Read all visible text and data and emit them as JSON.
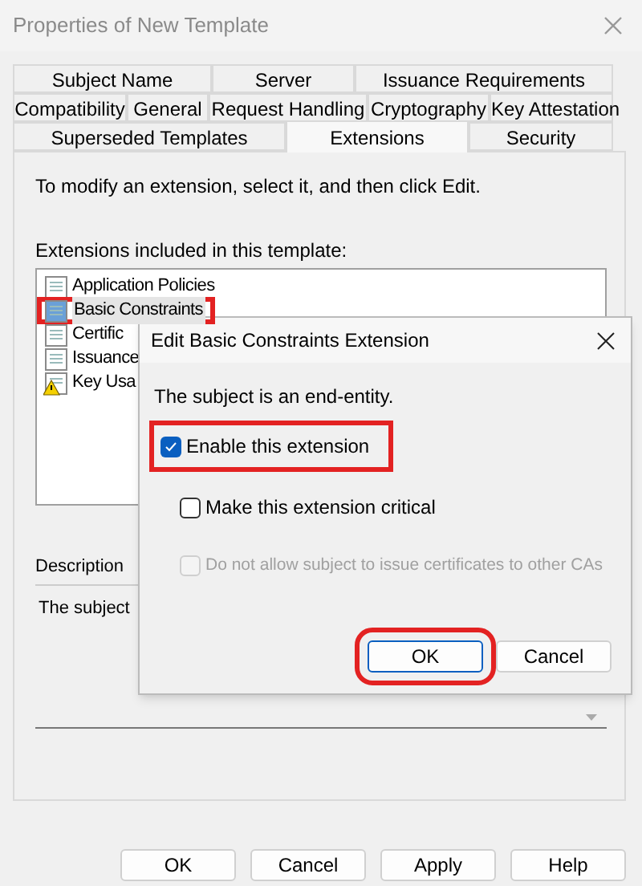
{
  "window": {
    "title": "Properties of New Template"
  },
  "tab_rows": [
    [
      {
        "label": "Subject Name",
        "selected": false
      },
      {
        "label": "Server",
        "selected": false
      },
      {
        "label": "Issuance Requirements",
        "selected": false
      }
    ],
    [
      {
        "label": "Compatibility",
        "selected": false
      },
      {
        "label": "General",
        "selected": false
      },
      {
        "label": "Request Handling",
        "selected": false
      },
      {
        "label": "Cryptography",
        "selected": false
      },
      {
        "label": "Key Attestation",
        "selected": false
      }
    ],
    [
      {
        "label": "Superseded Templates",
        "selected": false
      },
      {
        "label": "Extensions",
        "selected": true
      },
      {
        "label": "Security",
        "selected": false
      }
    ]
  ],
  "instruction": "To modify an extension, select it, and then click Edit.",
  "list_label": "Extensions included in this template:",
  "extensions": [
    {
      "label": "Application Policies",
      "kind": "document",
      "selected": false,
      "highlighted": false
    },
    {
      "label": "Basic Constraints",
      "kind": "document",
      "selected": true,
      "highlighted": true
    },
    {
      "label": "Certific",
      "kind": "document",
      "selected": false,
      "highlighted": false
    },
    {
      "label": "Issuance",
      "kind": "document",
      "selected": false,
      "highlighted": false
    },
    {
      "label": "Key Usa",
      "kind": "warning",
      "selected": false,
      "highlighted": false
    }
  ],
  "description_label": "Description",
  "description": "The subject",
  "buttons": [
    {
      "label": "OK"
    },
    {
      "label": "Cancel"
    },
    {
      "label": "Apply"
    },
    {
      "label": "Help"
    }
  ],
  "dialog": {
    "title": "Edit Basic Constraints Extension",
    "message": "The subject is an end-entity.",
    "options": [
      {
        "label": "Enable this extension",
        "checked": true,
        "disabled": false,
        "highlighted": true
      },
      {
        "label": "Make this extension critical",
        "checked": false,
        "disabled": false,
        "highlighted": false
      },
      {
        "label": "Do not allow subject to issue certificates to other CAs",
        "checked": false,
        "disabled": true,
        "highlighted": false
      }
    ],
    "buttons": [
      {
        "label": "OK",
        "highlighted": true
      },
      {
        "label": "Cancel",
        "highlighted": false
      }
    ]
  }
}
